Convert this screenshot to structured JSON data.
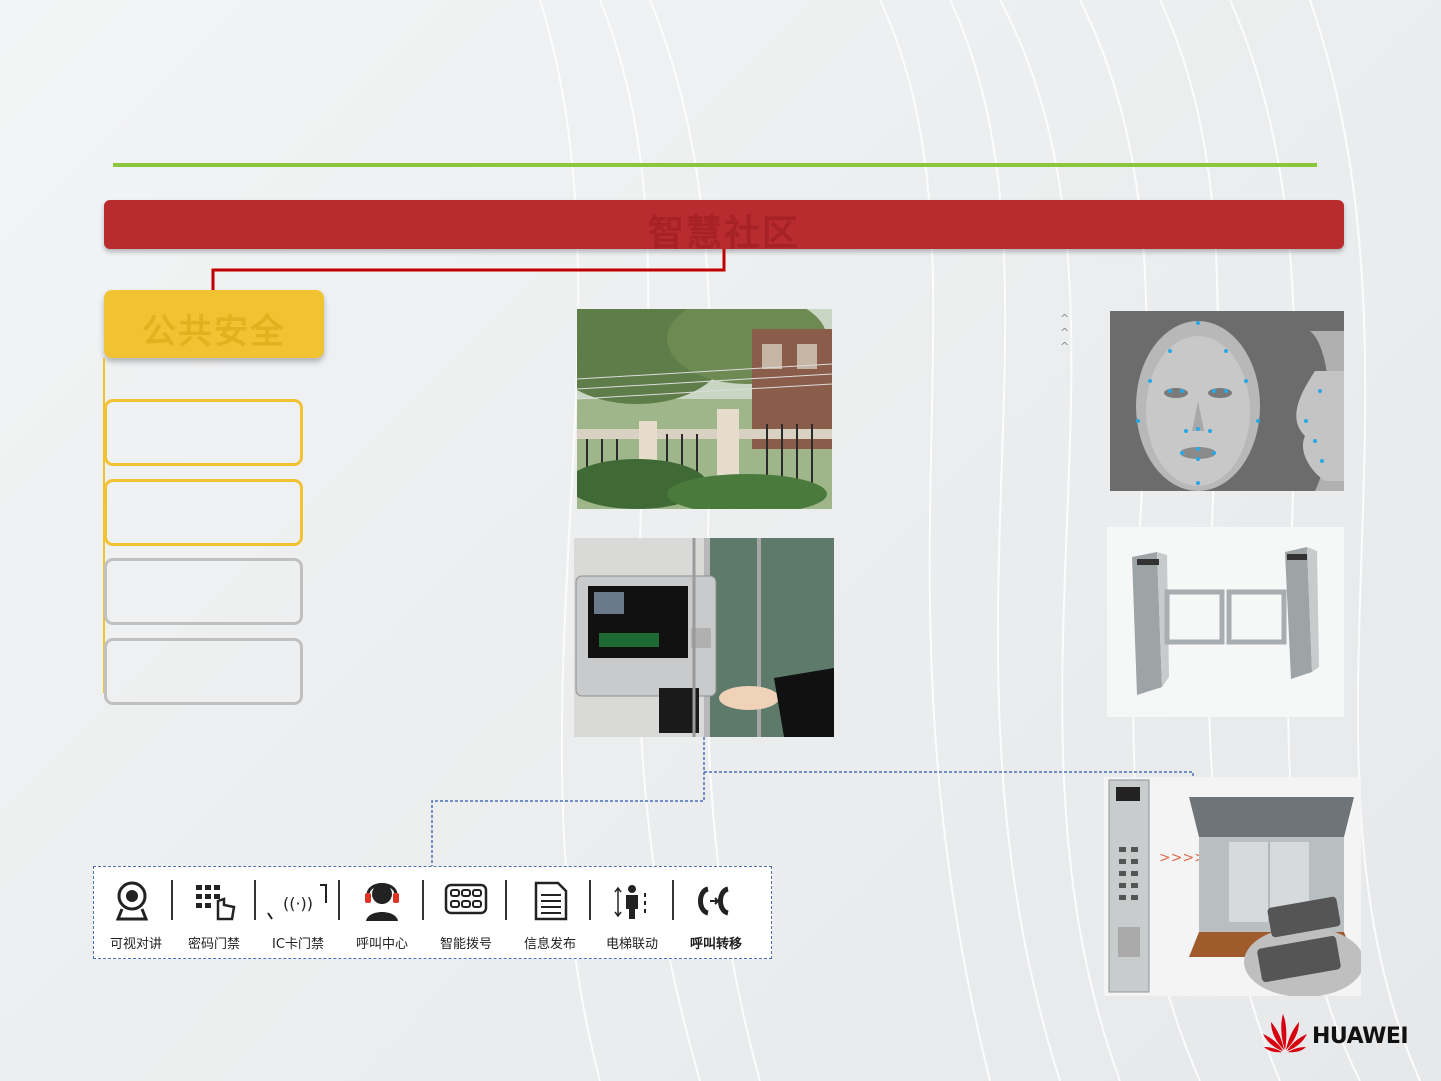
{
  "header": {
    "title": "智慧社区"
  },
  "category": {
    "title": "公共安全"
  },
  "icon_strip": {
    "items": [
      {
        "label": "可视对讲",
        "icon": "camera-icon"
      },
      {
        "label": "密码门禁",
        "icon": "keypad-icon"
      },
      {
        "label": "IC卡门禁",
        "icon": "card-reader-icon"
      },
      {
        "label": "呼叫中心",
        "icon": "headset-icon"
      },
      {
        "label": "智能拨号",
        "icon": "dialpad-icon"
      },
      {
        "label": "信息发布",
        "icon": "document-icon"
      },
      {
        "label": "电梯联动",
        "icon": "elevator-icon"
      },
      {
        "label": "呼叫转移",
        "icon": "call-forward-icon"
      }
    ]
  },
  "logo": {
    "text": "HUAWEI"
  },
  "colors": {
    "red": "#b82c2f",
    "gold": "#f1c232",
    "green": "#8cc63f",
    "gray": "#c0c0c0",
    "dash_blue": "#4a6fb5"
  }
}
